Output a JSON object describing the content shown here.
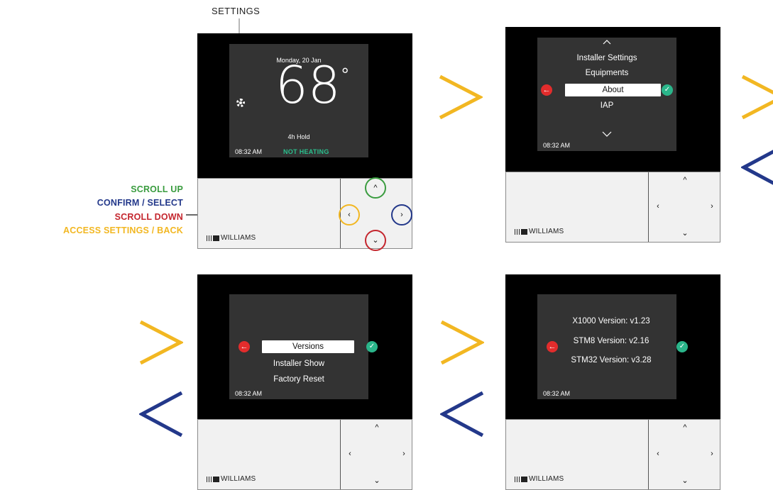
{
  "annotations": {
    "settings_label": "SETTINGS",
    "scroll_up": "SCROLL UP",
    "confirm_select": "CONFIRM / SELECT",
    "scroll_down": "SCROLL DOWN",
    "access_back": "ACCESS SETTINGS / BACK"
  },
  "brand": "WILLIAMS",
  "keys": {
    "up": "^",
    "down": "⌄",
    "left": "‹",
    "right": "›"
  },
  "screen1": {
    "date": "Monday, 20 Jan",
    "temperature": "68",
    "degree": "°",
    "hold": "4h Hold",
    "time": "08:32 AM",
    "status": "NOT HEATING"
  },
  "screen2": {
    "items": [
      "Installer Settings",
      "Equipments",
      "About",
      "IAP"
    ],
    "selected": "About",
    "time": "08:32 AM"
  },
  "screen3": {
    "selected": "Versions",
    "items": [
      "Installer Show",
      "Factory Reset"
    ],
    "time": "08:32 AM"
  },
  "screen4": {
    "lines": [
      "X1000 Version: v1.23",
      "STM8 Version: v2.16",
      "STM32 Version: v3.28"
    ],
    "time": "08:32 AM"
  },
  "colors": {
    "green": "#3a9c3f",
    "blue": "#23388a",
    "red": "#c4262e",
    "yellow": "#f2b722",
    "status_teal": "#2abf8d",
    "screen_bg": "#333333"
  },
  "icons": {
    "back": "arrow-left-icon",
    "confirm": "check-icon",
    "settings": "gear-icon",
    "forward_flow": "chevron-right-icon",
    "back_flow": "chevron-left-icon"
  }
}
